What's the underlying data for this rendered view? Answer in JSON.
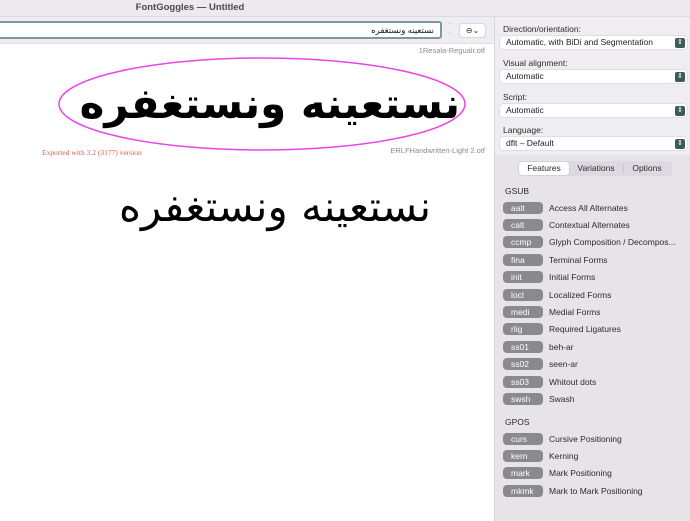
{
  "window": {
    "title": "FontGoggles — Untitled"
  },
  "toolbar": {
    "text_value": "نستعينه ونستغفره",
    "stepper_up": "⌃",
    "stepper_down": "⌄",
    "options_icon": "⊖⌄"
  },
  "canvas": {
    "fonts": [
      {
        "file_name": "1Resala-Regualr.otf",
        "sample_text": "نستعينه ونستغفره",
        "selected": true
      },
      {
        "file_name": "ERLFHandwritten-Light 2.otf",
        "sample_text": "نستعينه ونستغفره",
        "selected": false
      }
    ],
    "export_note": "Exported with  3.2 (3177)  version",
    "highlight_color": "#e845e8",
    "export_note_color": "#e05a4e"
  },
  "sidebar": {
    "direction": {
      "label": "Direction/orientation:",
      "value": "Automatic, with BiDi and Segmentation"
    },
    "alignment": {
      "label": "Visual alignment:",
      "value": "Automatic"
    },
    "script": {
      "label": "Script:",
      "value": "Automatic"
    },
    "language": {
      "label": "Language:",
      "value": "dflt – Default"
    },
    "tabs": [
      {
        "label": "Features",
        "active": true
      },
      {
        "label": "Variations",
        "active": false
      },
      {
        "label": "Options",
        "active": false
      }
    ],
    "gsub": {
      "label": "GSUB",
      "features": [
        {
          "tag": "aalt",
          "name": "Access All Alternates"
        },
        {
          "tag": "calt",
          "name": "Contextual Alternates"
        },
        {
          "tag": "ccmp",
          "name": "Glyph Composition / Decompos..."
        },
        {
          "tag": "fina",
          "name": "Terminal Forms"
        },
        {
          "tag": "init",
          "name": "Initial Forms"
        },
        {
          "tag": "locl",
          "name": "Localized Forms"
        },
        {
          "tag": "medi",
          "name": "Medial Forms"
        },
        {
          "tag": "rlig",
          "name": "Required Ligatures"
        },
        {
          "tag": "ss01",
          "name": "beh-ar"
        },
        {
          "tag": "ss02",
          "name": "seen-ar"
        },
        {
          "tag": "ss03",
          "name": "Whitout dots"
        },
        {
          "tag": "swsh",
          "name": "Swash"
        }
      ]
    },
    "gpos": {
      "label": "GPOS",
      "features": [
        {
          "tag": "curs",
          "name": "Cursive Positioning"
        },
        {
          "tag": "kern",
          "name": "Kerning"
        },
        {
          "tag": "mark",
          "name": "Mark Positioning"
        },
        {
          "tag": "mkmk",
          "name": "Mark to Mark Positioning"
        }
      ]
    }
  }
}
